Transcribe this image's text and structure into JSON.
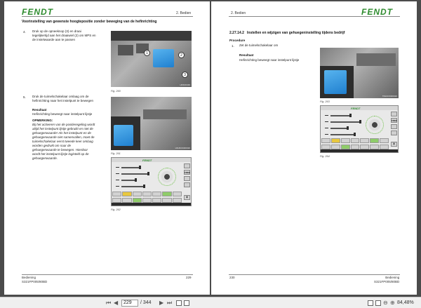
{
  "brand": "FENDT",
  "left_page": {
    "chapter": "2. Bedien",
    "heading": "Voorinstelling van gewenste hoogtepositie zonder beweging van de hefinrichting",
    "step4": {
      "num": "4.",
      "line1": "Druk op de opneeknop (3) en draai",
      "line2": "tegelijkertijd aan het draaiwiel (2) om MPS en",
      "line3": "de instelwaarde aan te passen"
    },
    "fig260": "Fig. 260",
    "photo1_code": "HNK00439",
    "callouts": [
      "1",
      "2",
      "3"
    ],
    "step5": {
      "num": "5.",
      "line1": "Druk de tuimelschakelaar omlaag om de",
      "line2": "hefinrichting naar het instelpunt te bewegen"
    },
    "result_label": "Resultaat",
    "result_text": "Hefinrichting beweegt naar instelpunt lijstje",
    "note_label": "OPMERKING:",
    "note_lines": [
      "Bij het activeren van de positieregeling wordt",
      "altijd het instelpunt lijstje gebruikt en niet de",
      "gehuegenwaarde! Als het instelpunt en de",
      "gehuegenwaarde niet samenvallen, moet de",
      "tuimelschakelaar eerst tweede keer omlaag",
      "worden gedrukt om naar de",
      "gehuegenwaarde te bewegen. Hierdoor",
      "wordt het instelpunt lijstje logisteld op de",
      "gehuegenwaarde."
    ],
    "fig261": "Fig. 261",
    "photo2_code": "HNJKF0300320",
    "fig262": "Fig. 262",
    "footer_left": "Bediening",
    "footer_code": "S321FP005/80BD",
    "page_number": "229"
  },
  "right_page": {
    "chapter": "2. Bedien",
    "section_num": "2.27.14.2",
    "section_title": "Instellen en wijzigen van gehuegeninstelling tijdens bedrijf",
    "procedure_label": "Procedure",
    "step1": {
      "num": "1.",
      "text": "Zet de tuimelschakelaar om"
    },
    "result_label": "Resultaat",
    "result_text": "Hefinrichting beweegt naar instelpunt lijstje",
    "fig263": "Fig. 263",
    "photo_code": "TRLKF0300320",
    "fig264": "Fig. 264",
    "footer_left": "Bediening",
    "footer_code": "S321FP005/80BD",
    "page_number": "230"
  },
  "screen": {
    "brand": "FENDT",
    "side_top_label": "FREE",
    "close_glyph": "✕"
  },
  "toolbar": {
    "first": "⏮",
    "prev": "◀",
    "current_page": "229",
    "total": "/ 344",
    "next": "▶",
    "last": "⏭",
    "zoom_out": "⊖",
    "zoom_in": "⊕",
    "zoom": "84,48%"
  }
}
